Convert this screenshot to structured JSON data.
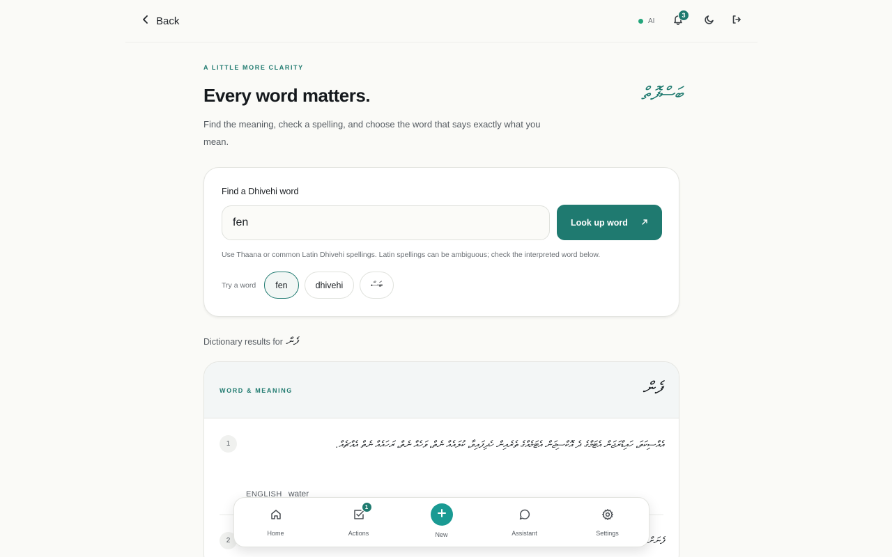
{
  "topbar": {
    "back_label": "Back",
    "ai_label": "AI",
    "notification_count": "3"
  },
  "hero": {
    "eyebrow": "A LITTLE MORE CLARITY",
    "title": "Every word matters.",
    "thaana_title": "ބަސްފޮތް",
    "subtitle": "Find the meaning, check a spelling, and choose the word that says exactly what you mean."
  },
  "search": {
    "label": "Find a Dhivehi word",
    "value": "fen",
    "button_label": "Look up word",
    "hint": "Use Thaana or common Latin Dhivehi spellings. Latin spellings can be ambiguous; check the interpreted word below.",
    "try_label": "Try a word",
    "suggestions": [
      "fen",
      "dhivehi",
      "ބަސް"
    ]
  },
  "results": {
    "prefix": "Dictionary results for",
    "word": "ފެން",
    "eyebrow": "WORD & MEANING",
    "senses": [
      {
        "number": "1",
        "text": "އެއްސިކަތަ، ހައިޑްރަޖަން އެޓަމްގެ ދެ އޮކްސިޖަން އެޓަމެއްގެ ތެރެއިން ހެދިފައިވާ، ކުލައެއް ނެތް، ވަހެއް ނެތް، ރަހައެއް ނެތް އެއްޗެއް.",
        "english_label": "ENGLISH",
        "english_value": "water"
      },
      {
        "number": "2",
        "text": "ފެނަށް"
      }
    ]
  },
  "bottom_nav": {
    "items": [
      {
        "label": "Home"
      },
      {
        "label": "Actions",
        "badge": "1"
      },
      {
        "label": "New"
      },
      {
        "label": "Assistant"
      },
      {
        "label": "Settings"
      }
    ]
  },
  "colors": {
    "accent": "#1f7a70",
    "accent_bright": "#1a9a93",
    "background": "#fafaf7",
    "ai_status": "#23a57b"
  }
}
